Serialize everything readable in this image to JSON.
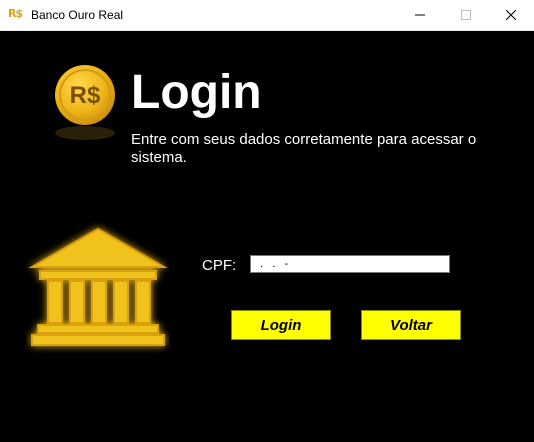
{
  "window": {
    "title": "Banco Ouro Real",
    "app_icon_text": "R$",
    "controls": [
      "minimize-icon",
      "maximize-icon",
      "close-icon"
    ]
  },
  "header": {
    "coin_symbol": "R$",
    "title": "Login",
    "subtitle": "Entre com seus dados corretamente para acessar o sistema."
  },
  "form": {
    "cpf_label": "CPF:",
    "cpf_value": "  .   .   -",
    "login_label": "Login",
    "voltar_label": "Voltar"
  },
  "icons": {
    "coin": "coin-icon",
    "bank": "bank-icon"
  },
  "colors": {
    "background": "#000000",
    "accent_gold": "#f2c21b",
    "button_yellow": "#ffff00",
    "text": "#ffffff"
  }
}
